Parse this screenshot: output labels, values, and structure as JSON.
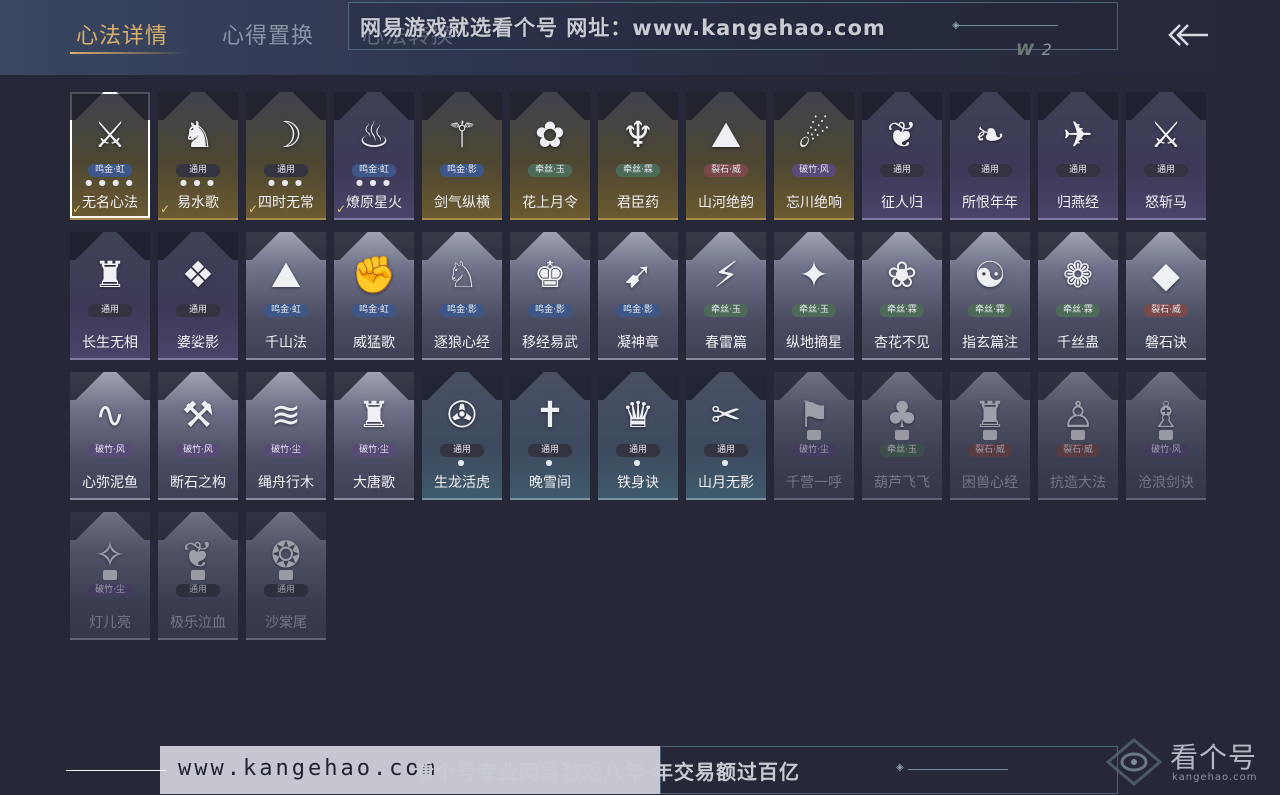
{
  "tabs": [
    "心法详情",
    "心得置换",
    "心法转换"
  ],
  "watermark_top": "网易游戏就选看个号   网址：www.kangehao.com",
  "currency": {
    "icon": "W",
    "count": "2"
  },
  "back_icon": "back-arrow-icon",
  "cards": [
    {
      "name": "无名心法",
      "tag": "鸣金·虹",
      "dots": "● ● ● ●",
      "style": "gold",
      "glyph": "⚔",
      "checked": true,
      "selected": true
    },
    {
      "name": "易水歌",
      "tag": "通用",
      "dots": "● ● ●",
      "style": "gold",
      "glyph": "♞",
      "checked": true
    },
    {
      "name": "四时无常",
      "tag": "通用",
      "dots": "● ● ●",
      "style": "gold",
      "glyph": "☽",
      "checked": true
    },
    {
      "name": "燎原星火",
      "tag": "鸣金·虹",
      "dots": "● ● ●",
      "style": "purple",
      "glyph": "♨",
      "checked": true
    },
    {
      "name": "剑气纵横",
      "tag": "鸣金·影",
      "dots": "",
      "style": "gold",
      "glyph": "⚚"
    },
    {
      "name": "花上月令",
      "tag": "牵丝·玉",
      "dots": "",
      "style": "gold",
      "glyph": "✿"
    },
    {
      "name": "君臣药",
      "tag": "牵丝·霖",
      "dots": "",
      "style": "gold",
      "glyph": "♆"
    },
    {
      "name": "山河绝韵",
      "tag": "裂石·威",
      "dots": "",
      "style": "gold",
      "glyph": "⛰"
    },
    {
      "name": "忘川绝响",
      "tag": "破竹·风",
      "dots": "",
      "style": "gold",
      "glyph": "☄"
    },
    {
      "name": "征人归",
      "tag": "通用",
      "dots": "",
      "style": "purple",
      "glyph": "❦"
    },
    {
      "name": "所恨年年",
      "tag": "通用",
      "dots": "",
      "style": "purple",
      "glyph": "❧"
    },
    {
      "name": "归燕经",
      "tag": "通用",
      "dots": "",
      "style": "purple",
      "glyph": "✈"
    },
    {
      "name": "怒斩马",
      "tag": "通用",
      "dots": "",
      "style": "purple",
      "glyph": "⚔"
    },
    {
      "name": "长生无相",
      "tag": "通用",
      "dots": "",
      "style": "purple",
      "glyph": "♜"
    },
    {
      "name": "婆娑影",
      "tag": "通用",
      "dots": "",
      "style": "purple",
      "glyph": "❖"
    },
    {
      "name": "千山法",
      "tag": "鸣金·虹",
      "dots": "",
      "style": "light",
      "glyph": "⛰"
    },
    {
      "name": "威猛歌",
      "tag": "鸣金·虹",
      "dots": "",
      "style": "light",
      "glyph": "✊"
    },
    {
      "name": "逐狼心经",
      "tag": "鸣金·影",
      "dots": "",
      "style": "light",
      "glyph": "♘"
    },
    {
      "name": "移经易武",
      "tag": "鸣金·影",
      "dots": "",
      "style": "light",
      "glyph": "♚"
    },
    {
      "name": "凝神章",
      "tag": "鸣金·影",
      "dots": "",
      "style": "light",
      "glyph": "➹"
    },
    {
      "name": "春雷篇",
      "tag": "牵丝·玉",
      "dots": "",
      "style": "light",
      "glyph": "⚡"
    },
    {
      "name": "纵地摘星",
      "tag": "牵丝·玉",
      "dots": "",
      "style": "light",
      "glyph": "✦"
    },
    {
      "name": "杏花不见",
      "tag": "牵丝·霖",
      "dots": "",
      "style": "light",
      "glyph": "❀"
    },
    {
      "name": "指玄篇注",
      "tag": "牵丝·霖",
      "dots": "",
      "style": "light",
      "glyph": "☯"
    },
    {
      "name": "千丝蛊",
      "tag": "牵丝·霖",
      "dots": "",
      "style": "light",
      "glyph": "❁"
    },
    {
      "name": "磐石诀",
      "tag": "裂石·威",
      "dots": "",
      "style": "light",
      "glyph": "◆"
    },
    {
      "name": "心弥泥鱼",
      "tag": "破竹·风",
      "dots": "",
      "style": "light",
      "glyph": "∿"
    },
    {
      "name": "断石之构",
      "tag": "破竹·风",
      "dots": "",
      "style": "light",
      "glyph": "⚒"
    },
    {
      "name": "绳舟行木",
      "tag": "破竹·尘",
      "dots": "",
      "style": "light",
      "glyph": "≋"
    },
    {
      "name": "大唐歌",
      "tag": "破竹·尘",
      "dots": "",
      "style": "light",
      "glyph": "♜"
    },
    {
      "name": "生龙活虎",
      "tag": "通用",
      "dots": "●",
      "style": "teal",
      "glyph": "✇"
    },
    {
      "name": "晚雪间",
      "tag": "通用",
      "dots": "●",
      "style": "teal",
      "glyph": "✝"
    },
    {
      "name": "铁身诀",
      "tag": "通用",
      "dots": "●",
      "style": "teal",
      "glyph": "♛"
    },
    {
      "name": "山月无影",
      "tag": "通用",
      "dots": "●",
      "style": "teal",
      "glyph": "✂"
    },
    {
      "name": "千营一呼",
      "tag": "破竹·尘",
      "dots": "",
      "style": "light",
      "glyph": "⚑",
      "locked": true
    },
    {
      "name": "葫芦飞飞",
      "tag": "牵丝·玉",
      "dots": "",
      "style": "light",
      "glyph": "♣",
      "locked": true
    },
    {
      "name": "困兽心经",
      "tag": "裂石·威",
      "dots": "",
      "style": "light",
      "glyph": "♜",
      "locked": true
    },
    {
      "name": "抗造大法",
      "tag": "裂石·威",
      "dots": "",
      "style": "light",
      "glyph": "♙",
      "locked": true
    },
    {
      "name": "沧浪剑诀",
      "tag": "破竹·风",
      "dots": "",
      "style": "light",
      "glyph": "♗",
      "locked": true
    },
    {
      "name": "灯儿亮",
      "tag": "破竹·尘",
      "dots": "",
      "style": "light",
      "glyph": "✧",
      "locked": true
    },
    {
      "name": "极乐泣血",
      "tag": "通用",
      "dots": "",
      "style": "light",
      "glyph": "❦",
      "locked": true
    },
    {
      "name": "沙棠尾",
      "tag": "通用",
      "dots": "",
      "style": "light",
      "glyph": "❂",
      "locked": true
    }
  ],
  "bottom_url": "www.kangehao.com",
  "bottom_text": "看个号专业网易游戏八年  年交易额过百亿",
  "logo": {
    "text": "看个号",
    "sub": "kangehao.com"
  },
  "colors": {
    "gold": "#d9b06a",
    "tag_blue": "#3d5788",
    "tag_green": "#4d6a58",
    "tag_red": "#7a4a4a",
    "background": "#262838"
  }
}
